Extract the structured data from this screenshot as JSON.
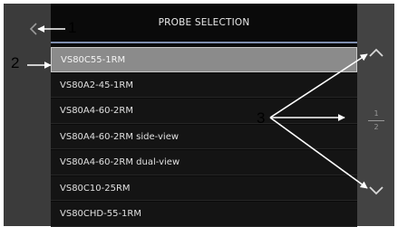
{
  "header": {
    "title": "PROBE SELECTION"
  },
  "probes": [
    {
      "label": "VS80C55-1RM",
      "selected": true
    },
    {
      "label": "VS80A2-45-1RM",
      "selected": false
    },
    {
      "label": "VS80A4-60-2RM",
      "selected": false
    },
    {
      "label": "VS80A4-60-2RM side-view",
      "selected": false
    },
    {
      "label": "VS80A4-60-2RM dual-view",
      "selected": false
    },
    {
      "label": "VS80C10-25RM",
      "selected": false
    },
    {
      "label": "VS80CHD-55-1RM",
      "selected": false
    }
  ],
  "pager": {
    "current": "1",
    "total": "2"
  },
  "callouts": {
    "back": "1",
    "selection": "2",
    "navigation": "3"
  },
  "icons": {
    "back": "chevron-left-icon",
    "up": "chevron-up-icon",
    "down": "chevron-down-icon"
  },
  "colors": {
    "panel": "#0a0a0a",
    "rail": "#3b3b3b",
    "selected": "#8b8b8b",
    "accent": "#7f8fb0"
  }
}
